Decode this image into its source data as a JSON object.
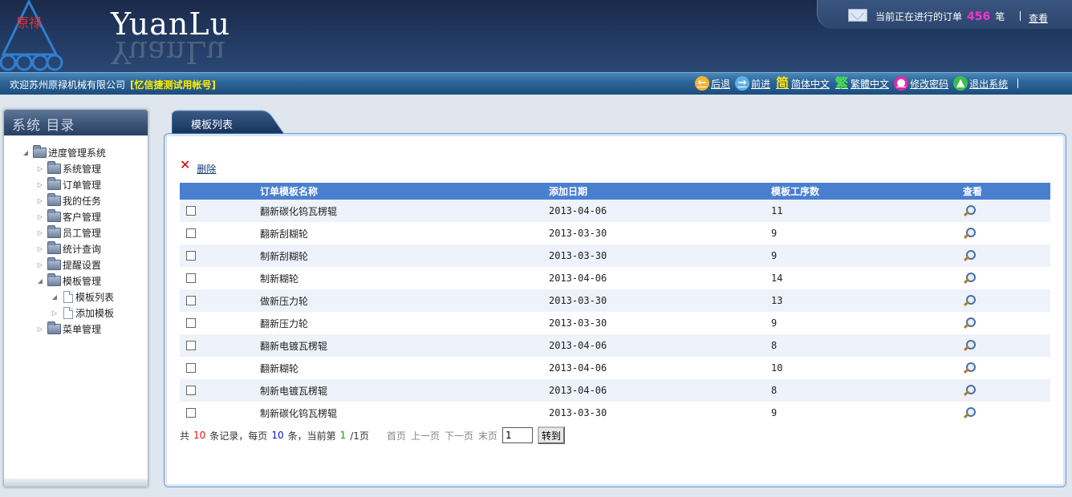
{
  "header": {
    "brand": "YuanLu",
    "brand_reflection": "YuanLu",
    "logo_text": "原禄",
    "order_prefix": "当前正在进行的订单",
    "order_count": "456",
    "order_suffix": "笔",
    "view_link": "查看"
  },
  "subbar": {
    "welcome": "欢迎苏州原禄机械有限公司",
    "account": "[忆信捷测试用帐号]",
    "nav": {
      "back": "后退",
      "forward": "前进",
      "simplified": "简体中文",
      "traditional": "繁體中文",
      "change_password": "修改密码",
      "logout": "退出系统"
    },
    "nav_icons": {
      "simplified_glyph": "简",
      "traditional_glyph": "繁"
    }
  },
  "sidebar": {
    "title": "系统 目录",
    "root": "进度管理系统",
    "items": [
      {
        "label": "系统管理"
      },
      {
        "label": "订单管理"
      },
      {
        "label": "我的任务"
      },
      {
        "label": "客户管理"
      },
      {
        "label": "员工管理"
      },
      {
        "label": "统计查询"
      },
      {
        "label": "提醒设置"
      },
      {
        "label": "模板管理"
      },
      {
        "label": "模板列表"
      },
      {
        "label": "添加模板"
      },
      {
        "label": "菜单管理"
      }
    ]
  },
  "main": {
    "tab": "模板列表",
    "delete_label": "删除",
    "columns": [
      "订单模板名称",
      "添加日期",
      "模板工序数",
      "查看"
    ],
    "rows": [
      {
        "name": "翻新碳化钨瓦楞辊",
        "date": "2013-04-06",
        "steps": "11"
      },
      {
        "name": "翻新刮糊轮",
        "date": "2013-03-30",
        "steps": "9"
      },
      {
        "name": "制新刮糊轮",
        "date": "2013-03-30",
        "steps": "9"
      },
      {
        "name": "制新糊轮",
        "date": "2013-04-06",
        "steps": "14"
      },
      {
        "name": "做新压力轮",
        "date": "2013-03-30",
        "steps": "13"
      },
      {
        "name": "翻新压力轮",
        "date": "2013-03-30",
        "steps": "9"
      },
      {
        "name": "翻新电镀瓦楞辊",
        "date": "2013-04-06",
        "steps": "8"
      },
      {
        "name": "翻新糊轮",
        "date": "2013-04-06",
        "steps": "10"
      },
      {
        "name": "制新电镀瓦楞辊",
        "date": "2013-04-06",
        "steps": "8"
      },
      {
        "name": "制新碳化钨瓦楞辊",
        "date": "2013-03-30",
        "steps": "9"
      }
    ]
  },
  "pager": {
    "t_total_prefix": "共",
    "total": "10",
    "t_total_suffix": "条记录，每页",
    "per_page": "10",
    "t_per_page_suffix": "条，当前第",
    "current": "1",
    "t_pages": "/1页",
    "first": "首页",
    "prev": "上一页",
    "next": "下一页",
    "last": "末页",
    "input_value": "1",
    "go": "转到"
  },
  "colors": {
    "header_bg": "#21385f",
    "table_header": "#4a7fd0",
    "row_alt": "#eef2fa",
    "order_count": "#ff33cc",
    "account": "#ffee00"
  }
}
